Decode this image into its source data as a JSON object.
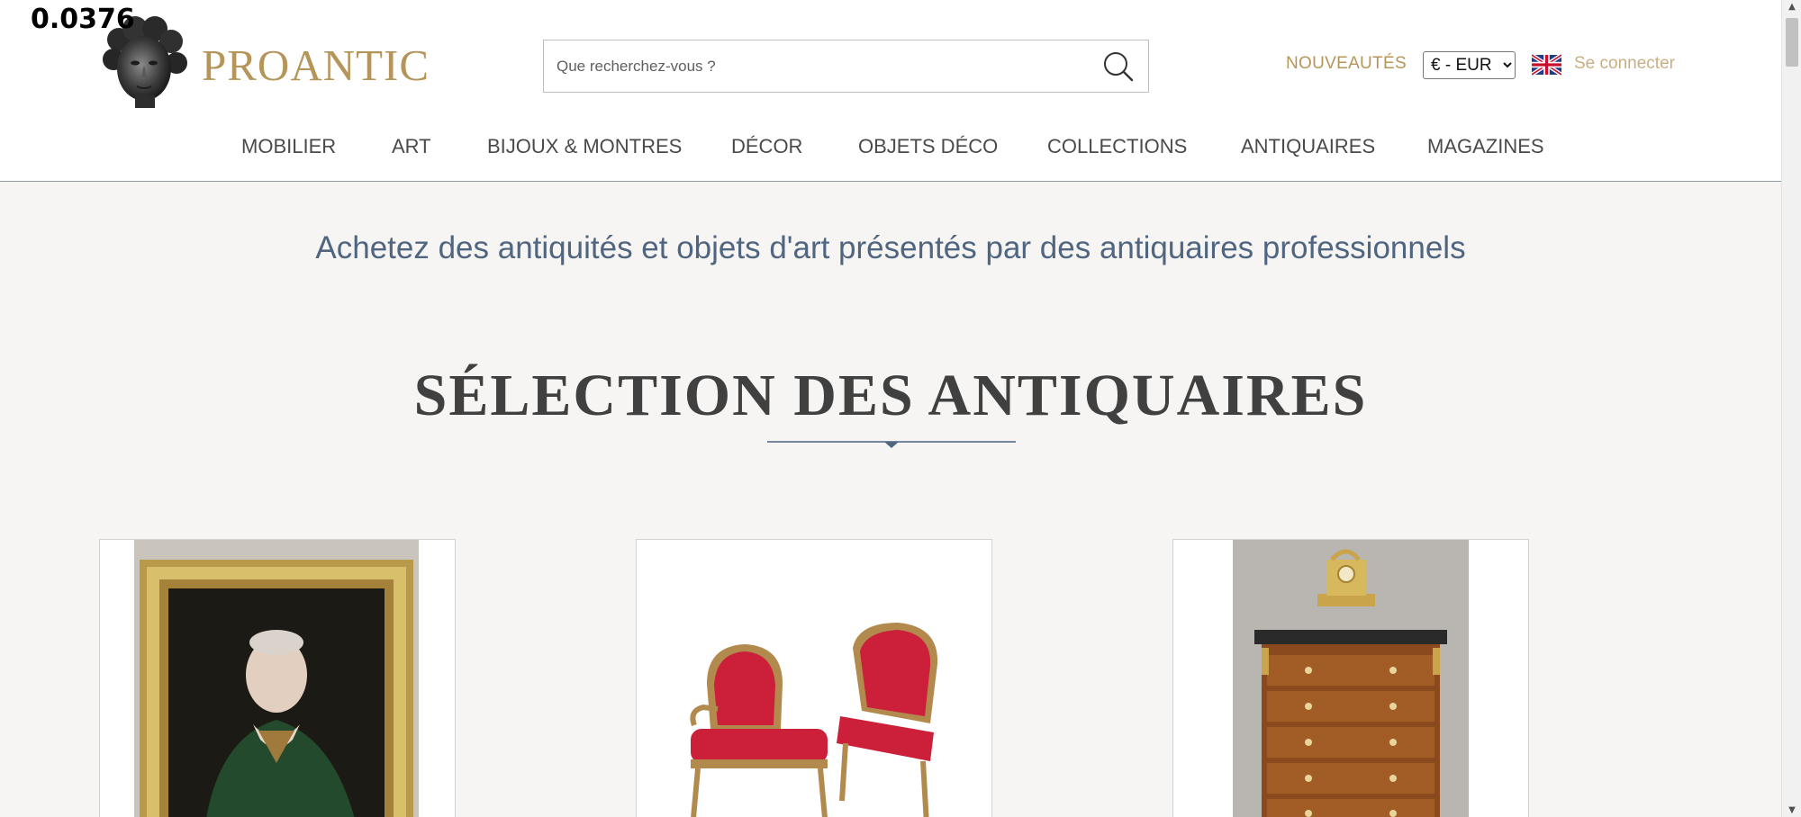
{
  "overlay": {
    "score": "0.0376"
  },
  "header": {
    "logo_text": "PROANTIC",
    "search_placeholder": "Que recherchez-vous ?",
    "nouveautes": "NOUVEAUTÉS",
    "currency_selected": "€ - EUR",
    "login": "Se connecter"
  },
  "nav": {
    "items": [
      {
        "label": "MOBILIER"
      },
      {
        "label": "ART"
      },
      {
        "label": "BIJOUX & MONTRES"
      },
      {
        "label": "DÉCOR"
      },
      {
        "label": "OBJETS DÉCO"
      },
      {
        "label": "COLLECTIONS"
      },
      {
        "label": "ANTIQUAIRES"
      },
      {
        "label": "MAGAZINES"
      }
    ]
  },
  "main": {
    "tagline": "Achetez des antiquités et objets d'art présentés par des antiquaires professionnels",
    "section_title": "SÉLECTION DES ANTIQUAIRES"
  },
  "colors": {
    "brand_gold": "#b5955a",
    "tagline_blue": "#4f6580",
    "background": "#f6f5f3"
  },
  "icons": {
    "search": "search-icon",
    "flag": "uk-flag-icon"
  }
}
